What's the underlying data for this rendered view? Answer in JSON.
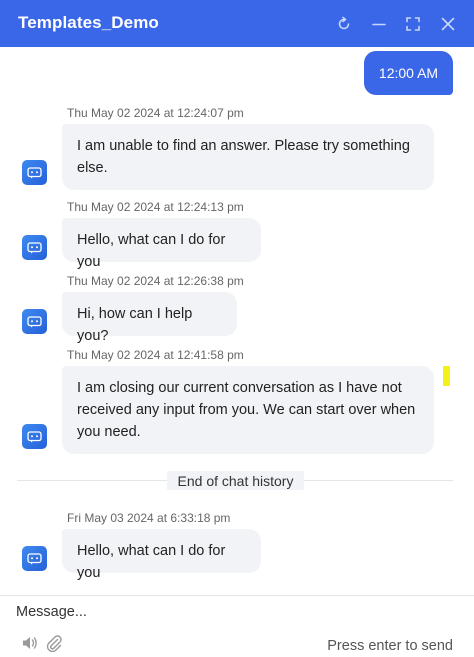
{
  "header": {
    "title": "Templates_Demo",
    "background": "#3a66e8"
  },
  "icons": {
    "refresh": "refresh-icon",
    "minimize": "minimize-icon",
    "expand": "expand-icon",
    "close": "close-icon",
    "bot": "chat-bot-icon",
    "speaker": "speaker-icon",
    "attach": "paperclip-icon"
  },
  "user_message": {
    "text": "12:00 AM"
  },
  "bot_messages": [
    {
      "timestamp": "Thu May 02 2024 at 12:24:07 pm",
      "text": "I am unable to find an answer. Please try something else."
    },
    {
      "timestamp": "Thu May 02 2024 at 12:24:13 pm",
      "text": "Hello, what can I do for you"
    },
    {
      "timestamp": "Thu May 02 2024 at 12:26:38 pm",
      "text": "Hi, how can I help you?"
    },
    {
      "timestamp": "Thu May 02 2024 at 12:41:58 pm",
      "text": "I am closing our current conversation as I have not received any input from you. We can start over when you need."
    },
    {
      "timestamp": "Fri May 03 2024 at 6:33:18 pm",
      "text": "Hello, what can I do for you"
    }
  ],
  "divider": {
    "label": "End of chat history"
  },
  "composer": {
    "placeholder": "Message...",
    "hint": "Press enter to send"
  }
}
